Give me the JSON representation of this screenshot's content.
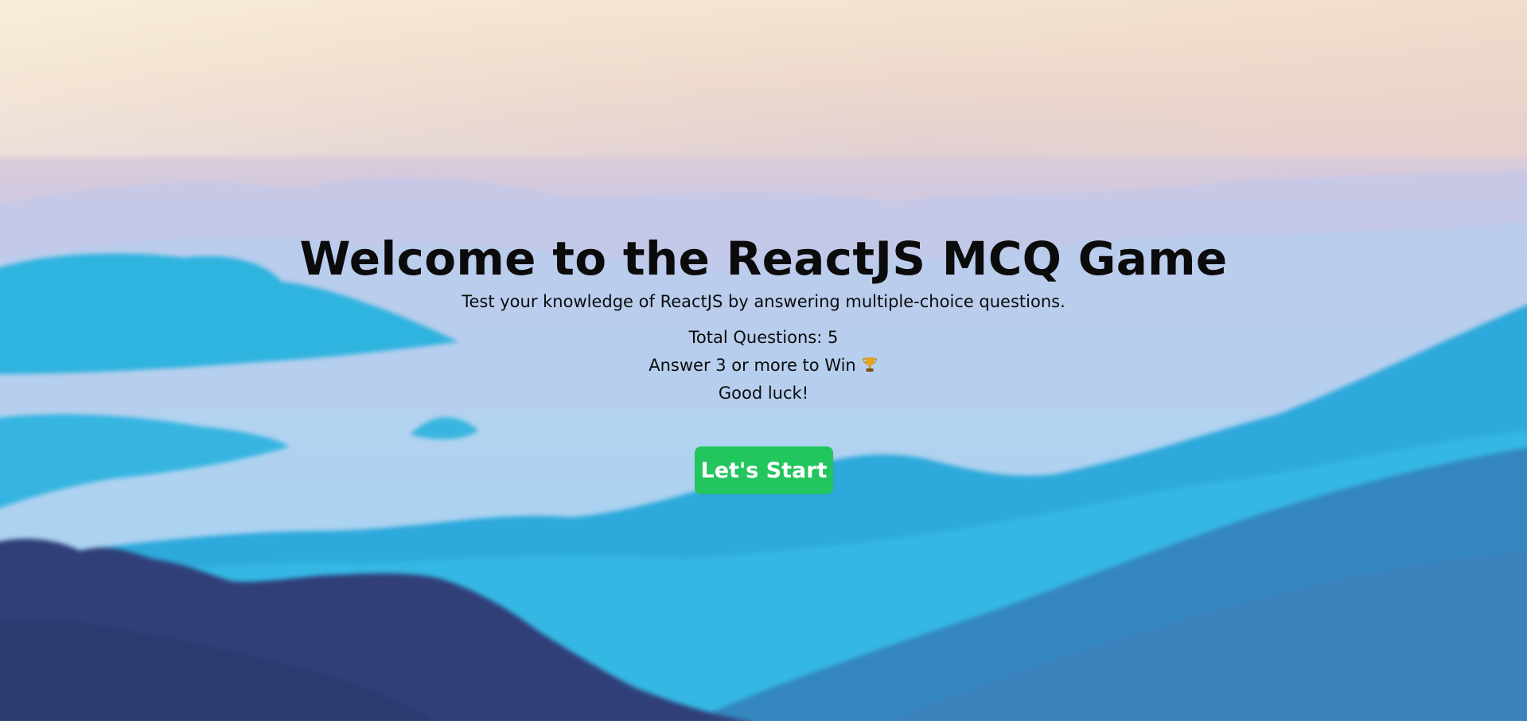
{
  "welcome": {
    "title": "Welcome to the ReactJS MCQ Game",
    "subtitle": "Test your knowledge of ReactJS by answering multiple-choice questions.",
    "total_questions": "Total Questions: 5",
    "win_condition": "Answer 3 or more to Win",
    "win_icon": "trophy-icon",
    "good_luck": "Good luck!",
    "start_label": "Let's Start"
  },
  "colors": {
    "button_bg": "#22c55e",
    "button_text": "#ffffff",
    "text": "#0b0b0b"
  }
}
